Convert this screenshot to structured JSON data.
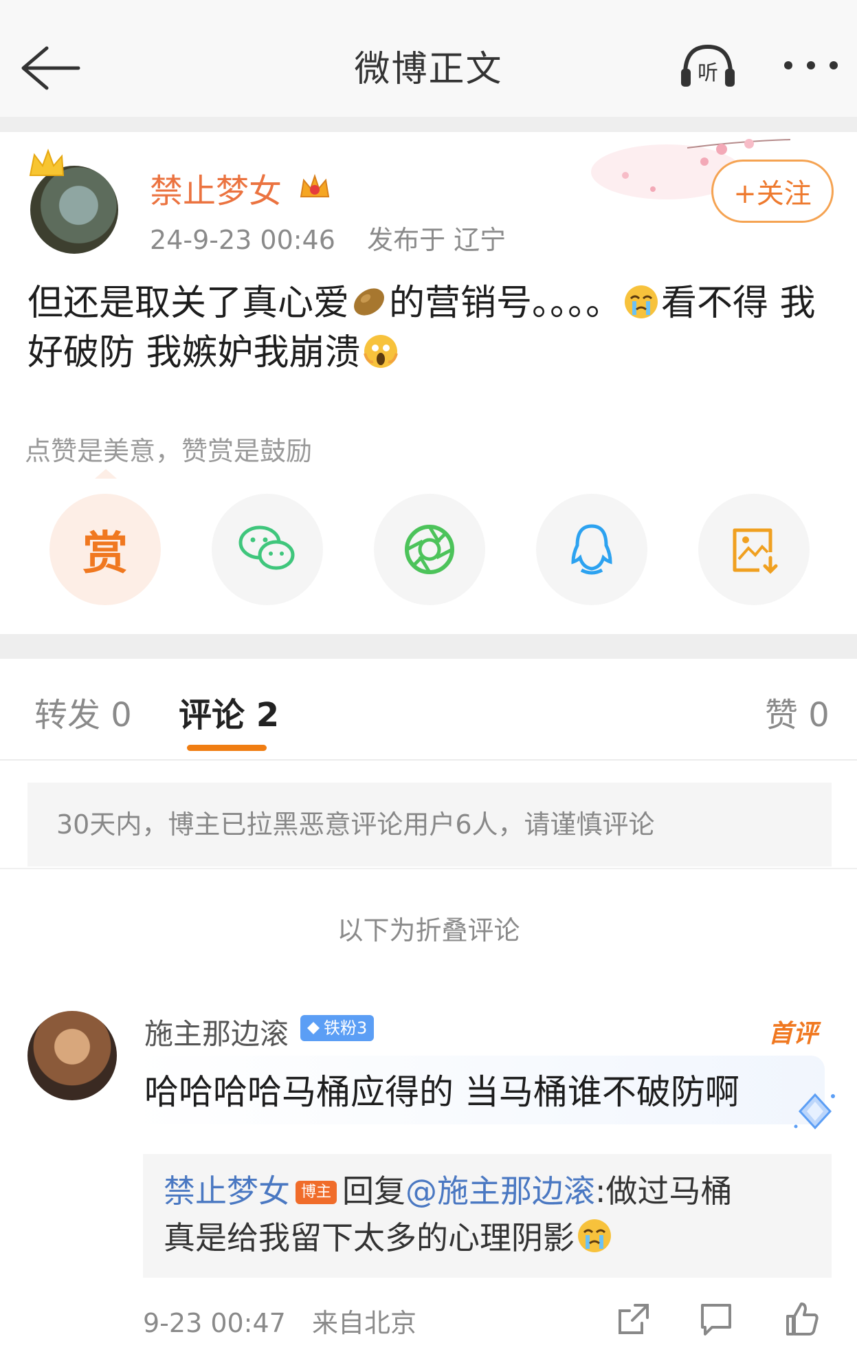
{
  "header": {
    "title": "微博正文",
    "listen_label": "听"
  },
  "post": {
    "username": "禁止梦女",
    "timestamp": "24-9-23 00:46",
    "location": "发布于 辽宁",
    "follow_label": "+关注",
    "text_1": "但还是取关了真心爱",
    "text_2": "的营销号。。。。",
    "text_3": "看不得 我好破防 我嫉妒我崩溃",
    "reward_tip": "点赞是美意，赞赏是鼓励",
    "reward_label": "赏"
  },
  "tabs": {
    "repost": "转发 0",
    "comments": "评论 2",
    "likes": "赞 0"
  },
  "notice": "30天内，博主已拉黑恶意评论用户6人，请谨慎评论",
  "folded_label": "以下为折叠评论",
  "comment": {
    "username": "施主那边滚",
    "fan_badge": "铁粉3",
    "first_badge": "首评",
    "text": "哈哈哈哈马桶应得的 当马桶谁不破防啊",
    "reply_author": "禁止梦女",
    "reply_badge": "博主",
    "reply_prefix": "回复",
    "reply_mention": "@施主那边滚",
    "reply_text_1": ":做过马桶",
    "reply_text_2": "真是给我留下太多的心理阴影",
    "timestamp": "9-23 00:47",
    "location": "来自北京"
  },
  "colors": {
    "accent_orange": "#f07820",
    "username_orange": "#eb7340",
    "link_blue": "#4a78c2",
    "badge_blue": "#5b9ef5",
    "wechat_green": "#3fc67c",
    "moments_green": "#4cc35a",
    "qq_blue": "#2ca2f0"
  }
}
